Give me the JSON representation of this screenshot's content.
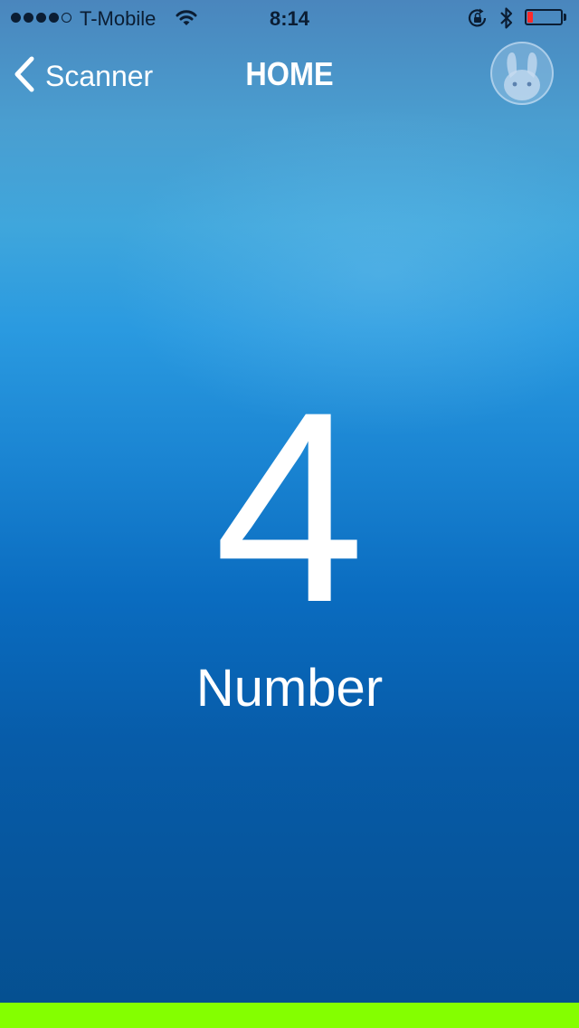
{
  "status_bar": {
    "signal_bars_filled": 4,
    "signal_bars_total": 5,
    "carrier": "T-Mobile",
    "time": "8:14",
    "battery_level": 0.15,
    "icons": [
      "wifi-icon",
      "rotation-lock-icon",
      "bluetooth-icon",
      "battery-icon"
    ]
  },
  "nav": {
    "back_label": "Scanner",
    "title": "HOME",
    "avatar_icon": "bunny-avatar-icon"
  },
  "main": {
    "value": "4",
    "label": "Number"
  },
  "colors": {
    "status_text": "#0b1d33",
    "battery_low": "#ff2a2a",
    "bottom_bar": "#84ff00",
    "text": "#ffffff"
  }
}
